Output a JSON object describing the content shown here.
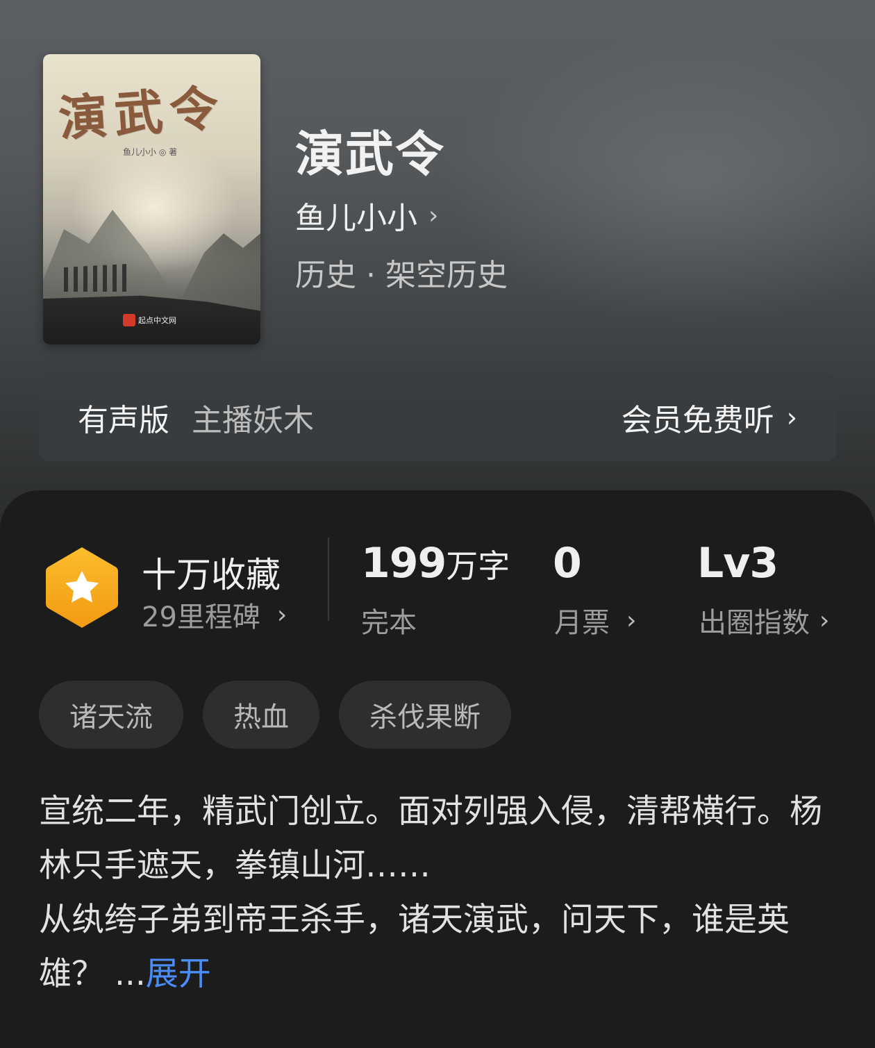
{
  "book": {
    "title": "演武令",
    "author": "鱼儿小小",
    "category": "历史 · 架空历史",
    "cover": {
      "title": "演武令",
      "author_line": "鱼儿小小 ◎ 著",
      "publisher": "起点中文网"
    }
  },
  "audio": {
    "label": "有声版",
    "narrator": "主播妖木",
    "cta": "会员免费听"
  },
  "stats": {
    "collection": {
      "main": "十万收藏",
      "sub": "29里程碑"
    },
    "words": {
      "number": "199",
      "unit": "万字",
      "sub": "完本"
    },
    "monthly_ticket": {
      "number": "0",
      "sub": "月票"
    },
    "circle_index": {
      "number": "Lv3",
      "sub": "出圈指数"
    }
  },
  "tags": [
    "诸天流",
    "热血",
    "杀伐果断"
  ],
  "synopsis": {
    "line1": "宣统二年，精武门创立。面对列强入侵，清帮横行。杨林只手遮天，拳镇山河……",
    "line2": "从纨绔子弟到帝王杀手，诸天演武，问天下，谁是英雄？",
    "ellipsis": "...",
    "expand": "展开"
  },
  "icons": {
    "chevron": "chevron-right-icon",
    "badge": "star-hexagon-icon"
  },
  "colors": {
    "accent_link": "#4b8df8",
    "badge_orange": "#f6a21a"
  }
}
